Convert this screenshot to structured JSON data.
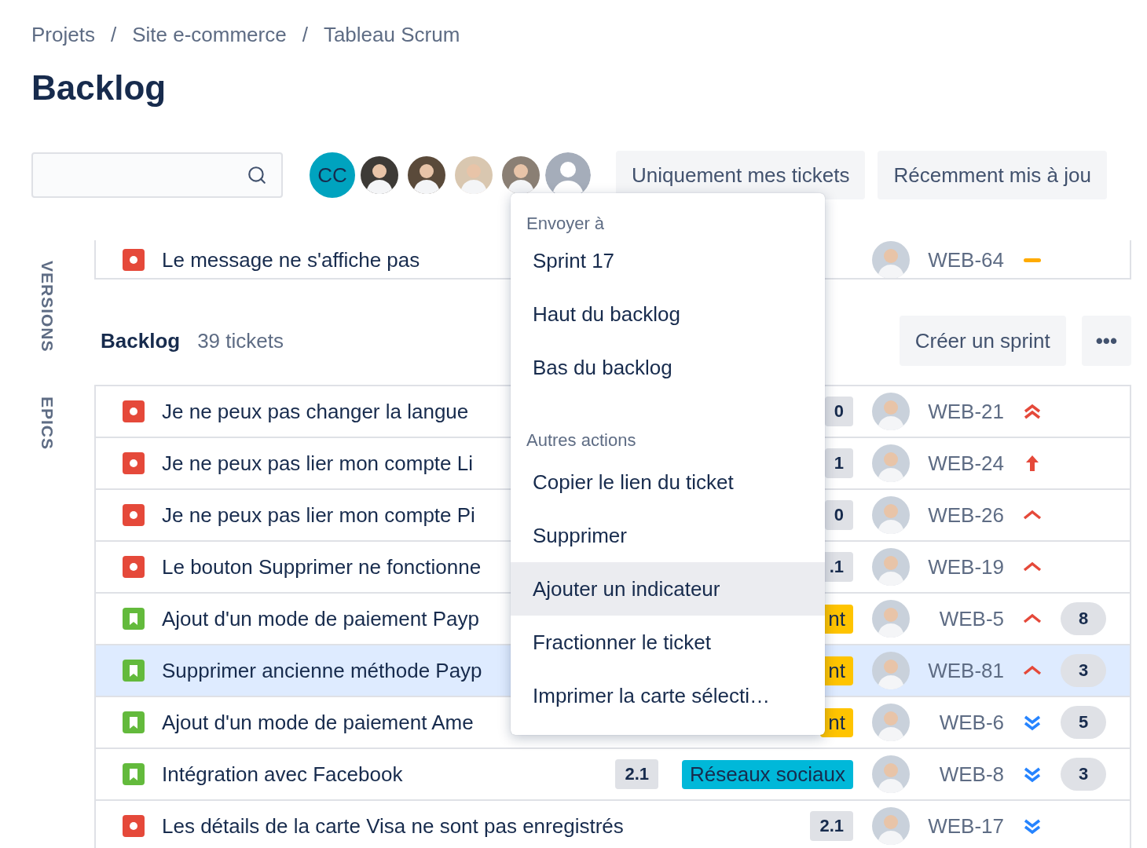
{
  "breadcrumbs": [
    {
      "label": "Projets"
    },
    {
      "separator": "/",
      "label": "Site e-commerce"
    },
    {
      "separator": "/",
      "label": "Tableau Scrum"
    }
  ],
  "title": "Backlog",
  "avatars": [
    {
      "kind": "initials",
      "text": "CC"
    },
    {
      "kind": "photo"
    },
    {
      "kind": "photo"
    },
    {
      "kind": "photo"
    },
    {
      "kind": "photo"
    },
    {
      "kind": "default"
    }
  ],
  "filters": [
    {
      "label": "Uniquement mes tickets"
    },
    {
      "label": "Récemment mis à jou"
    }
  ],
  "side_tabs": [
    "VERSIONS",
    "EPICS"
  ],
  "sprint_tail": {
    "issue_type": {
      "kind": "bug"
    },
    "summary": "Le message ne s'affiche pas",
    "key": "WEB-64",
    "priority": {
      "kind": "medium"
    }
  },
  "backlog": {
    "title": "Backlog",
    "count": "39 tickets",
    "create_button": "Créer un sprint",
    "more_button": "•••"
  },
  "rows": [
    {
      "issue_type": {
        "kind": "bug"
      },
      "summary": "Je ne peux pas changer la langue",
      "version": "0",
      "key": "WEB-21",
      "priority": {
        "kind": "highest"
      },
      "selected": false
    },
    {
      "issue_type": {
        "kind": "bug"
      },
      "summary": "Je ne peux pas lier mon compte Li",
      "version": "1",
      "key": "WEB-24",
      "priority": {
        "kind": "critical"
      },
      "selected": false
    },
    {
      "issue_type": {
        "kind": "bug"
      },
      "summary": "Je ne peux pas lier mon compte Pi",
      "version": "0",
      "key": "WEB-26",
      "priority": {
        "kind": "high"
      },
      "selected": false
    },
    {
      "issue_type": {
        "kind": "bug"
      },
      "summary": "Le bouton Supprimer ne fonctionne",
      "version": ".1",
      "key": "WEB-19",
      "priority": {
        "kind": "high"
      },
      "selected": false
    },
    {
      "issue_type": {
        "kind": "story"
      },
      "summary": "Ajout d'un mode de paiement Payp",
      "epic": {
        "label": "nt",
        "color": "#ffc400"
      },
      "key": "WEB-5",
      "priority": {
        "kind": "high"
      },
      "estimate": "8",
      "selected": false
    },
    {
      "issue_type": {
        "kind": "story"
      },
      "summary": "Supprimer ancienne méthode Payp",
      "epic": {
        "label": "nt",
        "color": "#ffc400"
      },
      "key": "WEB-81",
      "priority": {
        "kind": "high"
      },
      "estimate": "3",
      "selected": true
    },
    {
      "issue_type": {
        "kind": "story"
      },
      "summary": "Ajout d'un mode de paiement Ame",
      "epic": {
        "label": "nt",
        "color": "#ffc400"
      },
      "key": "WEB-6",
      "priority": {
        "kind": "lowest"
      },
      "estimate": "5",
      "selected": false
    },
    {
      "issue_type": {
        "kind": "story"
      },
      "summary": "Intégration avec Facebook",
      "version": "2.1",
      "epic": {
        "label": "Réseaux sociaux",
        "color": "#00b8d9"
      },
      "key": "WEB-8",
      "priority": {
        "kind": "lowest"
      },
      "estimate": "3",
      "selected": false
    },
    {
      "issue_type": {
        "kind": "bug"
      },
      "summary": "Les détails de la carte Visa ne sont pas enregistrés",
      "version": "2.1",
      "key": "WEB-17",
      "priority": {
        "kind": "lowest"
      },
      "selected": false
    }
  ],
  "menu": {
    "sections": [
      {
        "heading": "Envoyer à",
        "items": [
          {
            "label": "Sprint 17",
            "active": false
          },
          {
            "label": "Haut du backlog",
            "active": false
          },
          {
            "label": "Bas du backlog",
            "active": false
          }
        ]
      },
      {
        "heading": "Autres actions",
        "items": [
          {
            "label": "Copier le lien du ticket",
            "active": false
          },
          {
            "label": "Supprimer",
            "active": false
          },
          {
            "label": "Ajouter un indicateur",
            "active": true
          },
          {
            "label": "Fractionner le ticket",
            "active": false
          },
          {
            "label": "Imprimer la carte sélecti…",
            "active": false
          }
        ]
      }
    ]
  }
}
